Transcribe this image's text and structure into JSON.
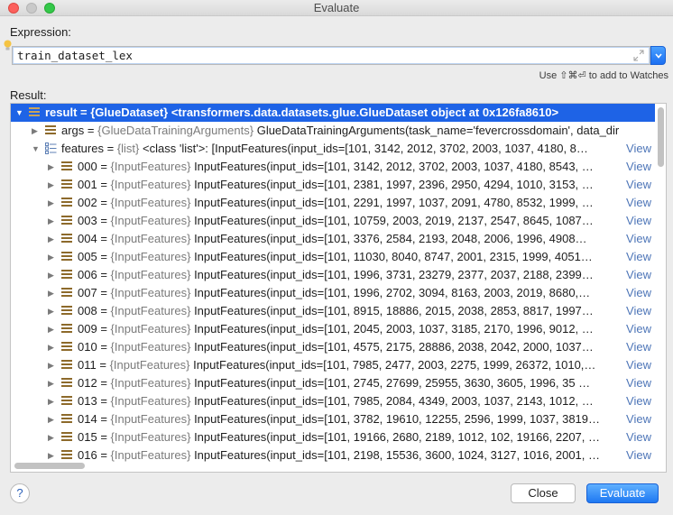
{
  "window": {
    "title": "Evaluate"
  },
  "expression": {
    "label": "Expression:",
    "value": "train_dataset_lex",
    "hint": "Use ⇧⌘⏎ to add to Watches"
  },
  "result": {
    "label": "Result:",
    "rows": [
      {
        "name": "result",
        "type": "{GlueDataset}",
        "value": "<transformers.data.datasets.glue.GlueDataset object at 0x126fa8610>",
        "expanded": true,
        "selected": true,
        "icon": "field",
        "has_view": false
      },
      {
        "name": "args",
        "type": "{GlueDataTrainingArguments}",
        "value": "GlueDataTrainingArguments(task_name='fevercrossdomain', data_dir",
        "expanded": false,
        "icon": "field",
        "has_view": false
      },
      {
        "name": "features",
        "type": "{list}",
        "value": "<class 'list'>: [InputFeatures(input_ids=[101, 3142, 2012, 3702, 2003, 1037, 4180, 8…",
        "expanded": true,
        "icon": "list",
        "has_view": true
      },
      {
        "name": "000",
        "type": "{InputFeatures}",
        "value": "InputFeatures(input_ids=[101, 3142, 2012, 3702, 2003, 1037, 4180, 8543, …",
        "expanded": false,
        "icon": "field",
        "has_view": true
      },
      {
        "name": "001",
        "type": "{InputFeatures}",
        "value": "InputFeatures(input_ids=[101, 2381, 1997, 2396, 2950, 4294, 1010, 3153, …",
        "expanded": false,
        "icon": "field",
        "has_view": true
      },
      {
        "name": "002",
        "type": "{InputFeatures}",
        "value": "InputFeatures(input_ids=[101, 2291, 1997, 1037, 2091, 4780, 8532, 1999, …",
        "expanded": false,
        "icon": "field",
        "has_view": true
      },
      {
        "name": "003",
        "type": "{InputFeatures}",
        "value": "InputFeatures(input_ids=[101, 10759, 2003, 2019, 2137, 2547, 8645, 1087…",
        "expanded": false,
        "icon": "field",
        "has_view": true
      },
      {
        "name": "004",
        "type": "{InputFeatures}",
        "value": "InputFeatures(input_ids=[101, 3376, 2584, 2193, 2048, 2006, 1996, 4908…",
        "expanded": false,
        "icon": "field",
        "has_view": true
      },
      {
        "name": "005",
        "type": "{InputFeatures}",
        "value": "InputFeatures(input_ids=[101, 11030, 8040, 8747, 2001, 2315, 1999, 4051…",
        "expanded": false,
        "icon": "field",
        "has_view": true
      },
      {
        "name": "006",
        "type": "{InputFeatures}",
        "value": "InputFeatures(input_ids=[101, 1996, 3731, 23279, 2377, 2037, 2188, 2399…",
        "expanded": false,
        "icon": "field",
        "has_view": true
      },
      {
        "name": "007",
        "type": "{InputFeatures}",
        "value": "InputFeatures(input_ids=[101, 1996, 2702, 3094, 8163, 2003, 2019, 8680,…",
        "expanded": false,
        "icon": "field",
        "has_view": true
      },
      {
        "name": "008",
        "type": "{InputFeatures}",
        "value": "InputFeatures(input_ids=[101, 8915, 18886, 2015, 2038, 2853, 8817, 1997…",
        "expanded": false,
        "icon": "field",
        "has_view": true
      },
      {
        "name": "009",
        "type": "{InputFeatures}",
        "value": "InputFeatures(input_ids=[101, 2045, 2003, 1037, 3185, 2170, 1996, 9012, …",
        "expanded": false,
        "icon": "field",
        "has_view": true
      },
      {
        "name": "010",
        "type": "{InputFeatures}",
        "value": "InputFeatures(input_ids=[101, 4575, 2175, 28886, 2038, 2042, 2000, 1037…",
        "expanded": false,
        "icon": "field",
        "has_view": true
      },
      {
        "name": "011",
        "type": "{InputFeatures}",
        "value": "InputFeatures(input_ids=[101, 7985, 2477, 2003, 2275, 1999, 26372, 1010,…",
        "expanded": false,
        "icon": "field",
        "has_view": true
      },
      {
        "name": "012",
        "type": "{InputFeatures}",
        "value": "InputFeatures(input_ids=[101, 2745, 27699, 25955, 3630, 3605, 1996, 35 …",
        "expanded": false,
        "icon": "field",
        "has_view": true
      },
      {
        "name": "013",
        "type": "{InputFeatures}",
        "value": "InputFeatures(input_ids=[101, 7985, 2084, 4349, 2003, 1037, 2143, 1012, …",
        "expanded": false,
        "icon": "field",
        "has_view": true
      },
      {
        "name": "014",
        "type": "{InputFeatures}",
        "value": "InputFeatures(input_ids=[101, 3782, 19610, 12255, 2596, 1999, 1037, 3819…",
        "expanded": false,
        "icon": "field",
        "has_view": true
      },
      {
        "name": "015",
        "type": "{InputFeatures}",
        "value": "InputFeatures(input_ids=[101, 19166, 2680, 2189, 1012, 102, 19166, 2207, …",
        "expanded": false,
        "icon": "field",
        "has_view": true
      },
      {
        "name": "016",
        "type": "{InputFeatures}",
        "value": "InputFeatures(input_ids=[101, 2198, 15536, 3600, 1024, 3127, 1016, 2001, …",
        "expanded": false,
        "icon": "field",
        "has_view": true
      }
    ],
    "view_label": "View",
    "eq": " = "
  },
  "footer": {
    "help_label": "?",
    "close_label": "Close",
    "evaluate_label": "Evaluate"
  }
}
